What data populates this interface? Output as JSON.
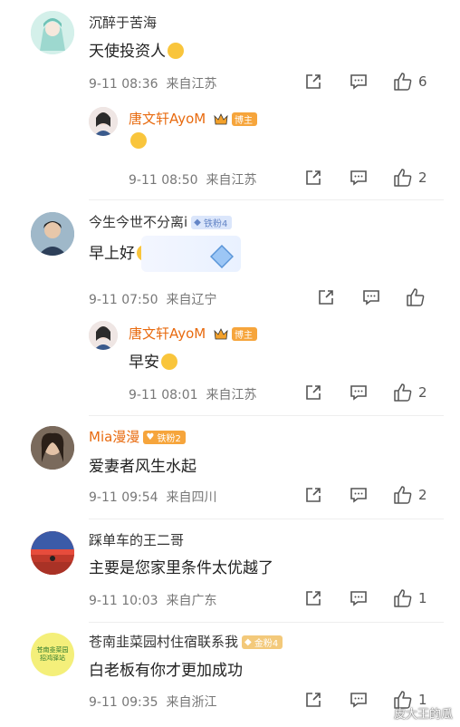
{
  "comments": [
    {
      "user": "沉醉于苦海",
      "text": "天使投资人",
      "date": "9-11 08:36",
      "location": "来自江苏",
      "likes": "6",
      "reply": {
        "user": "唐文轩AyoM",
        "badge": "博主",
        "text": "",
        "date": "9-11 08:50",
        "location": "来自江苏",
        "likes": "2"
      }
    },
    {
      "user": "今生今世不分离i",
      "badge": "铁粉4",
      "text": "早上好",
      "date": "9-11 07:50",
      "location": "来自辽宁",
      "likes": "",
      "reply": {
        "user": "唐文轩AyoM",
        "badge": "博主",
        "text": "早安",
        "date": "9-11 08:01",
        "location": "来自江苏",
        "likes": "2"
      }
    },
    {
      "user": "Mia漫漫",
      "badge": "铁粉2",
      "text": "爱妻者风生水起",
      "date": "9-11 09:54",
      "location": "来自四川",
      "likes": "2"
    },
    {
      "user": "踩单车的王二哥",
      "text": "主要是您家里条件太优越了",
      "date": "9-11 10:03",
      "location": "来自广东",
      "likes": "1"
    },
    {
      "user": "苍南韭菜园村住宿联系我",
      "badge": "金粉4",
      "avatar_text": "苍南韭菜园 招鸿驿站",
      "text": "白老板有你才更加成功",
      "date": "9-11 09:35",
      "location": "来自浙江",
      "likes": "1"
    }
  ],
  "watermark": "皮大王的瓜",
  "colors": {
    "accent_orange": "#e86b10",
    "meta_gray": "#777777"
  }
}
